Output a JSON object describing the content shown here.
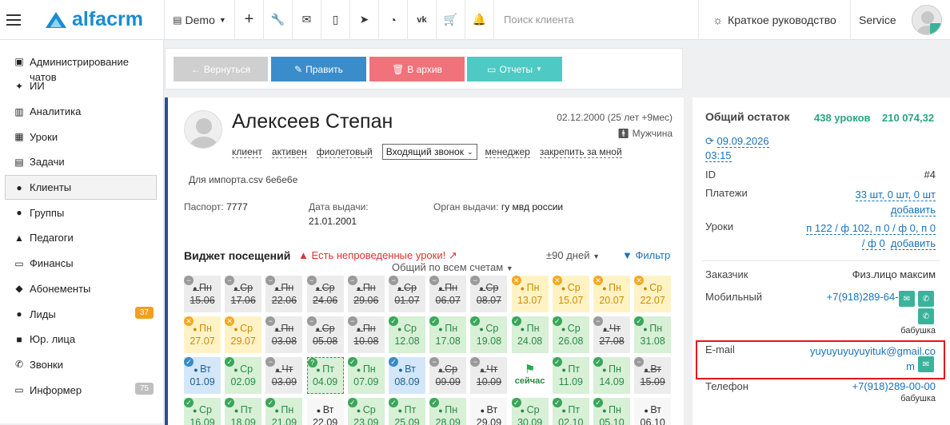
{
  "topbar": {
    "logo_text": "alfacrm",
    "demo": "Demo",
    "search_placeholder": "Поиск клиента",
    "guide": "Краткое руководство",
    "service": "Service"
  },
  "sidebar": {
    "items": [
      {
        "label": "Администрирование чатов",
        "icon": "chat-icon"
      },
      {
        "label": "ИИ",
        "icon": "sparkle-icon"
      },
      {
        "label": "Аналитика",
        "icon": "book-icon"
      },
      {
        "label": "Уроки",
        "icon": "calendar-icon"
      },
      {
        "label": "Задачи",
        "icon": "clipboard-icon"
      },
      {
        "label": "Клиенты",
        "icon": "user-icon",
        "active": true
      },
      {
        "label": "Группы",
        "icon": "users-icon"
      },
      {
        "label": "Педагоги",
        "icon": "graduation-icon"
      },
      {
        "label": "Финансы",
        "icon": "money-icon"
      },
      {
        "label": "Абонементы",
        "icon": "tag-icon"
      },
      {
        "label": "Лиды",
        "icon": "lead-icon",
        "count": "37",
        "count_color": "#f0a020"
      },
      {
        "label": "Юр. лица",
        "icon": "briefcase-icon"
      },
      {
        "label": "Звонки",
        "icon": "phone-icon"
      },
      {
        "label": "Информер",
        "icon": "monitor-icon",
        "count": "75",
        "count_color": "#bfbfbf"
      }
    ]
  },
  "actions": {
    "back": "Вернуться",
    "edit": "Править",
    "archive": "В архив",
    "reports": "Отчеты"
  },
  "client": {
    "name": "Алексеев Степан",
    "dob": "02.12.2000 (25 лет +9мес)",
    "gender": "Мужчина",
    "tags": [
      "клиент",
      "активен",
      "фиолетовый"
    ],
    "status_select": "Входящий звонок",
    "manager_label": "менеджер",
    "pin_label": "закрепить за мной",
    "note": "Для импорта.csv 6e6e6e",
    "passport_label": "Паспорт:",
    "passport_value": "7777",
    "issue_date_label": "Дата выдачи:",
    "issue_date_value": "21.01.2001",
    "issuer_label": "Орган выдачи:",
    "issuer_value": "гу мвд россии"
  },
  "widget": {
    "title": "Виджет посещений",
    "warning": "Есть непроведенные уроки!",
    "days": "±90 дней",
    "filter": "Фильтр",
    "subtitle": "Общий по всем счетам",
    "rows": [
      [
        {
          "d": "Пн",
          "t": "15.06",
          "k": "s"
        },
        {
          "d": "Ср",
          "t": "17.06",
          "k": "s"
        },
        {
          "d": "Пн",
          "t": "22.06",
          "k": "s"
        },
        {
          "d": "Ср",
          "t": "24.06",
          "k": "s"
        },
        {
          "d": "Пн",
          "t": "29.06",
          "k": "s"
        },
        {
          "d": "Ср",
          "t": "01.07",
          "k": "s"
        },
        {
          "d": "Пн",
          "t": "06.07",
          "k": "s"
        },
        {
          "d": "Ср",
          "t": "08.07",
          "k": "s"
        },
        {
          "d": "Пн",
          "t": "13.07",
          "k": "y"
        },
        {
          "d": "Ср",
          "t": "15.07",
          "k": "y"
        },
        {
          "d": "Пн",
          "t": "20.07",
          "k": "y"
        },
        {
          "d": "Ср",
          "t": "22.07",
          "k": "y"
        }
      ],
      [
        {
          "d": "Пн",
          "t": "27.07",
          "k": "y"
        },
        {
          "d": "Ср",
          "t": "29.07",
          "k": "y"
        },
        {
          "d": "Пн",
          "t": "03.08",
          "k": "s"
        },
        {
          "d": "Ср",
          "t": "05.08",
          "k": "s"
        },
        {
          "d": "Пн",
          "t": "10.08",
          "k": "s"
        },
        {
          "d": "Ср",
          "t": "12.08",
          "k": "g"
        },
        {
          "d": "Пн",
          "t": "17.08",
          "k": "g"
        },
        {
          "d": "Ср",
          "t": "19.08",
          "k": "g"
        },
        {
          "d": "Пн",
          "t": "24.08",
          "k": "g"
        },
        {
          "d": "Ср",
          "t": "26.08",
          "k": "g"
        },
        {
          "d": "Чт",
          "t": "27.08",
          "k": "s"
        },
        {
          "d": "Пн",
          "t": "31.08",
          "k": "g"
        }
      ],
      [
        {
          "d": "Вт",
          "t": "01.09",
          "k": "b"
        },
        {
          "d": "Ср",
          "t": "02.09",
          "k": "g"
        },
        {
          "d": "Чт",
          "t": "03.09",
          "k": "s"
        },
        {
          "d": "Пт",
          "t": "04.09",
          "k": "q"
        },
        {
          "d": "Пн",
          "t": "07.09",
          "k": "g"
        },
        {
          "d": "Вт",
          "t": "08.09",
          "k": "b"
        },
        {
          "d": "Ср",
          "t": "09.09",
          "k": "s"
        },
        {
          "d": "Чт",
          "t": "10.09",
          "k": "s"
        },
        {
          "d": "сейчас",
          "t": "",
          "k": "now"
        },
        {
          "d": "Пт",
          "t": "11.09",
          "k": "g"
        },
        {
          "d": "Пн",
          "t": "14.09",
          "k": "g"
        },
        {
          "d": "Вт",
          "t": "15.09",
          "k": "s"
        }
      ],
      [
        {
          "d": "Ср",
          "t": "16.09",
          "k": "g"
        },
        {
          "d": "Пт",
          "t": "18.09",
          "k": "g"
        },
        {
          "d": "Пн",
          "t": "21.09",
          "k": "g"
        },
        {
          "d": "Вт",
          "t": "22.09",
          "k": "w"
        },
        {
          "d": "Ср",
          "t": "23.09",
          "k": "g"
        },
        {
          "d": "Пт",
          "t": "25.09",
          "k": "g"
        },
        {
          "d": "Пн",
          "t": "28.09",
          "k": "g"
        },
        {
          "d": "Вт",
          "t": "29.09",
          "k": "w"
        },
        {
          "d": "Ср",
          "t": "30.09",
          "k": "g"
        },
        {
          "d": "Пт",
          "t": "02.10",
          "k": "g"
        },
        {
          "d": "Пн",
          "t": "05.10",
          "k": "g"
        },
        {
          "d": "Вт",
          "t": "06.10",
          "k": "w"
        }
      ]
    ]
  },
  "summary": {
    "title": "Общий остаток",
    "lessons": "438 уроков",
    "amount": "210 074,32",
    "date": "09.09.2026",
    "time": "03:15",
    "id_label": "ID",
    "id_value": "#4",
    "payments_label": "Платежи",
    "payments_value": "33 шт, 0 шт, 0 шт",
    "add": "добавить",
    "lessons_label": "Уроки",
    "lessons_value_1": "п 122 / ф 102, п 0 / ф 0, п 0",
    "lessons_value_2": "/ ф 0",
    "customer_label": "Заказчик",
    "customer_value": "Физ.лицо максим",
    "mobile_label": "Мобильный",
    "mobile_value": "+7(918)289-64-89",
    "mobile_note": "бабушка",
    "email_label": "E-mail",
    "email_value_1": "yuyuyuyuyuyituk@gmail.co",
    "email_value_2": "m",
    "phone_label": "Телефон",
    "phone_value": "+7(918)289-00-00",
    "phone_note": "бабушка"
  }
}
